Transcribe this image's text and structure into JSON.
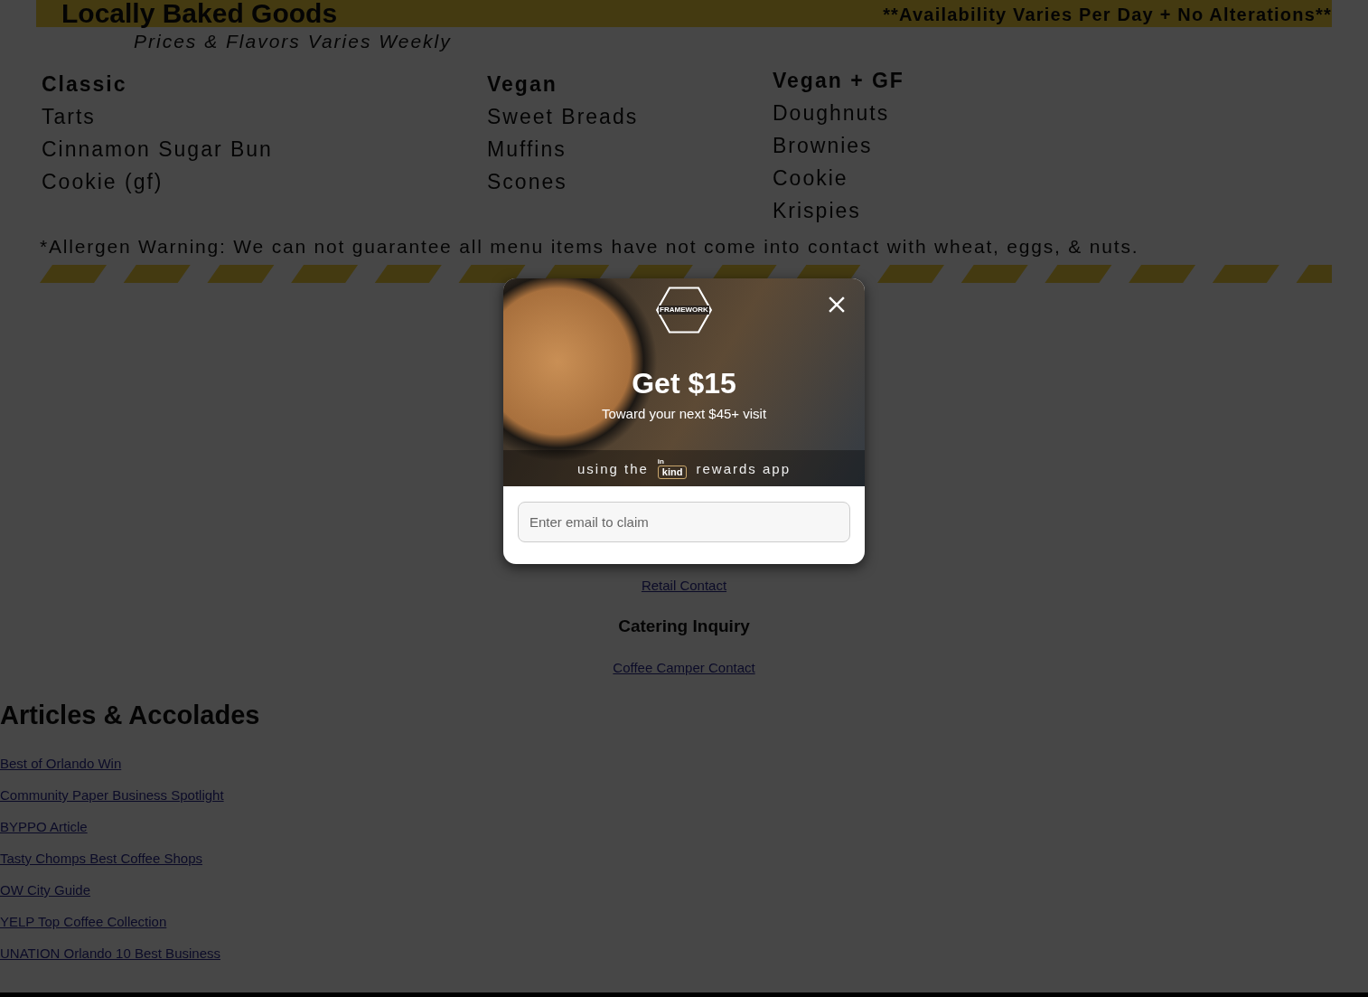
{
  "menu_board": {
    "title": "Locally Baked Goods",
    "notice": "**Availability Varies Per Day + No Alterations**",
    "subtitle": "Prices & Flavors Varies Weekly",
    "columns": [
      {
        "heading": "Classic",
        "items": [
          "Tarts",
          "Cinnamon Sugar Bun",
          "Cookie (gf)"
        ]
      },
      {
        "heading": "Vegan",
        "items": [
          "Sweet Breads",
          "Muffins",
          "Scones"
        ]
      },
      {
        "heading": "Vegan + GF",
        "items": [
          "Doughnuts",
          "Brownies",
          "Cookie",
          "Krispies"
        ]
      }
    ],
    "allergen_warning": "*Allergen Warning: We can not guarantee all menu items have not come into contact with wheat, eggs, & nuts."
  },
  "contact": [
    {
      "kind": "link",
      "text": "Retail Contact"
    },
    {
      "kind": "heading",
      "text": "Catering Inquiry"
    },
    {
      "kind": "link",
      "text": "Coffee Camper Contact"
    }
  ],
  "articles": {
    "title": "Articles & Accolades",
    "links": [
      "Best of Orlando Win",
      "Community Paper Business Spotlight",
      "BYPPO Article",
      "Tasty Chomps Best Coffee Shops",
      "OW City Guide",
      "YELP Top Coffee Collection",
      "UNATION Orlando 10 Best Business"
    ]
  },
  "popup": {
    "logo": "FRAMEWORK",
    "headline": "Get $15",
    "subline": "Toward your next $45+ visit",
    "app_before": "using the",
    "app_logo": [
      "in",
      "kind"
    ],
    "app_after": "rewards app",
    "email_field": {
      "placeholder": "Enter email to claim"
    }
  }
}
